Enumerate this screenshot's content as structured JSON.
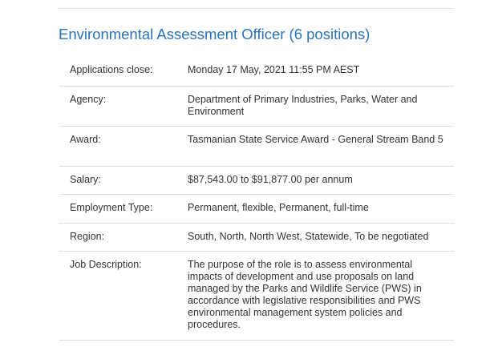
{
  "job": {
    "title": "Environmental Assessment Officer (6 positions)",
    "rows": [
      {
        "label": "Applications close:",
        "value": "Monday 17 May, 2021 11:55 PM AEST"
      },
      {
        "label": "Agency:",
        "value": "Department of Primary Industries, Parks, Water and Environment"
      },
      {
        "label": "Award:",
        "value": "Tasmanian State Service Award - General Stream Band 5"
      },
      {
        "label": "Salary:",
        "value": "$87,543.00 to $91,877.00 per annum"
      },
      {
        "label": "Employment Type:",
        "value": "Permanent, flexible, Permanent, full-time"
      },
      {
        "label": "Region:",
        "value": "South, North, North West, Statewide, To be negotiated"
      },
      {
        "label": "Job Description:",
        "value": "The purpose of the role is to assess environmental impacts of development and use proposals on land managed by the Parks and Wildlife Service (PWS) in accordance with legislative responsibilities and PWS environmental management system policies and procedures."
      }
    ]
  }
}
